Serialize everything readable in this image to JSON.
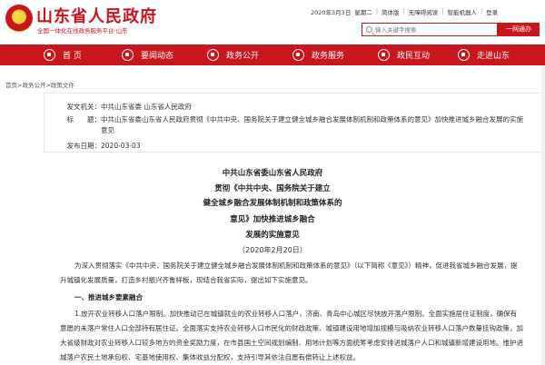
{
  "header": {
    "site_title": "山东省人民政府",
    "site_subtitle": "全国一体化在线政务服务平台·山东",
    "top_links": [
      "2020年3月3日",
      "星期二",
      "|",
      "简体版",
      "|",
      "无障碍阅读",
      "|",
      "智能机器人",
      "|",
      "登录"
    ],
    "search_placeholder": "输入关键字搜索",
    "search_button": "一网通办"
  },
  "nav": {
    "items": [
      {
        "label": "首  页",
        "icon": "home-icon"
      },
      {
        "label": "要闻动态",
        "icon": "news-icon"
      },
      {
        "label": "政务公开",
        "icon": "disclosure-icon"
      },
      {
        "label": "政务服务",
        "icon": "service-icon"
      },
      {
        "label": "政民互动",
        "icon": "interaction-icon"
      },
      {
        "label": "走进山东",
        "icon": "shandong-icon"
      }
    ]
  },
  "breadcrumb": "首页>政务公开>政策文件",
  "info": {
    "issuer_label": "发文机关：",
    "issuer": "中共山东省委  山东省人民政府",
    "title_label": "标　　题：",
    "title": "中共山东省委山东省人民政府贯彻《中共中央、国务院关于建立健全城乡融合发展体制机制和政策体系的意见》加快推进城乡融合发展的实施意见",
    "date_label": "发布日期：",
    "date": "2020-03-03"
  },
  "article": {
    "lines": [
      "中共山东省委山东省人民政府",
      "贯彻《中共中央、国务院关于建立",
      "健全城乡融合发展体制机制和政策体系的",
      "意见》加快推进城乡融合",
      "发展的实施意见"
    ],
    "date": "（2020年2月20日）",
    "intro": "为深入贯彻落实《中共中央、国务院关于建立健全城乡融合发展体制机制和政策体系的意见》（以下简称《意见》）精神，促进我省城乡融合发展，提升城镇化发展质量，打造乡村振兴齐鲁样板，现结合我省实际，提出如下实施意见。",
    "section1": "一、推进城乡要素融合",
    "para1": "1.放开农业转移人口落户限制。加快推动已在城镇就业的农业转移人口落户，济南、青岛中心城区尽快放开落户限制。全面实施居住证制度，确保有意愿的未落户常住人口全部持有居住证。全面落实支持农业转移人口市民化的财政政策、城镇建设用地增加规模与吸纳农业转移人口落户数量挂钩政策，加大省级财政对农业转移人口较多地方的资金奖励力度，在市县国土空间规划编制、用地计划等方面统筹考虑安排进城落户人口和城镇新增建设用地。维护进城落户农民土地承包权、宅基地使用权、集体收益分配权，支持引导其依法自愿有偿转让上述权益。"
  }
}
